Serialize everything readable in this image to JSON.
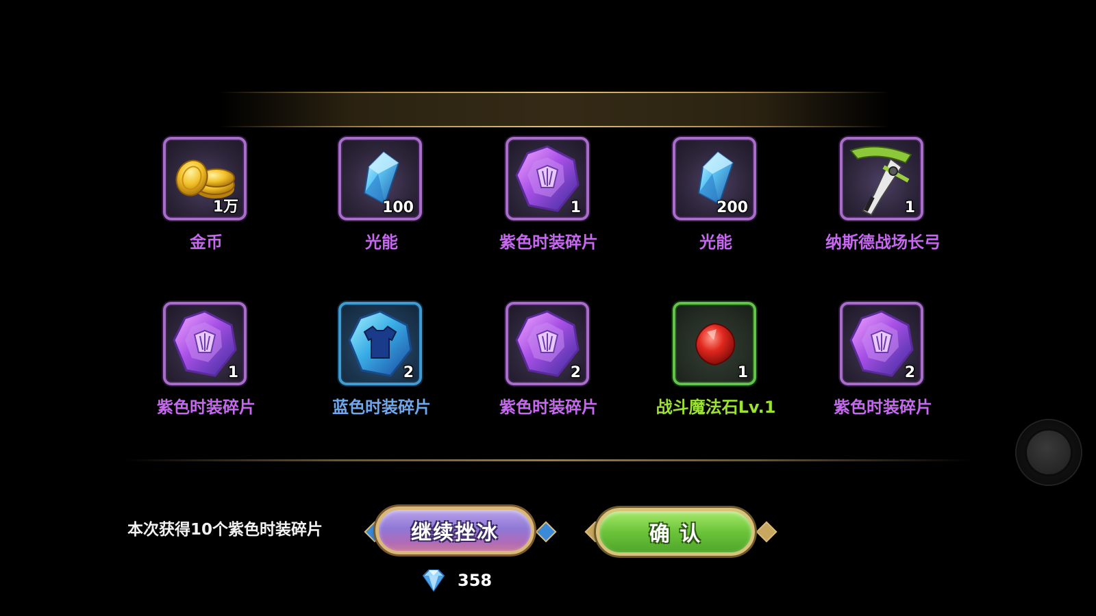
{
  "items": [
    {
      "name": "金币",
      "qty": "1万",
      "icon": "gold-coins-icon",
      "rarity": "purple"
    },
    {
      "name": "光能",
      "qty": "100",
      "icon": "light-crystal-icon",
      "rarity": "purple"
    },
    {
      "name": "紫色时装碎片",
      "qty": "1",
      "icon": "purple-costume-fragment-icon",
      "rarity": "purple"
    },
    {
      "name": "光能",
      "qty": "200",
      "icon": "light-crystal-icon",
      "rarity": "purple"
    },
    {
      "name": "纳斯德战场长弓",
      "qty": "1",
      "icon": "longbow-icon",
      "rarity": "purple"
    },
    {
      "name": "紫色时装碎片",
      "qty": "1",
      "icon": "purple-costume-fragment-icon",
      "rarity": "purple"
    },
    {
      "name": "蓝色时装碎片",
      "qty": "2",
      "icon": "blue-costume-fragment-icon",
      "rarity": "blue"
    },
    {
      "name": "紫色时装碎片",
      "qty": "2",
      "icon": "purple-costume-fragment-icon",
      "rarity": "purple"
    },
    {
      "name": "战斗魔法石Lv.1",
      "qty": "1",
      "icon": "red-magic-stone-icon",
      "rarity": "green"
    },
    {
      "name": "紫色时装碎片",
      "qty": "2",
      "icon": "purple-costume-fragment-icon",
      "rarity": "purple"
    }
  ],
  "footer": {
    "summary": "本次获得10个紫色时装碎片",
    "continue_label": "继续挫冰",
    "confirm_label": "确 认",
    "cost_value": "358",
    "cost_icon": "diamond-icon"
  },
  "colors": {
    "purple_text": "#c768f0",
    "blue_text": "#6ea8ee",
    "green_text": "#9be32e"
  }
}
